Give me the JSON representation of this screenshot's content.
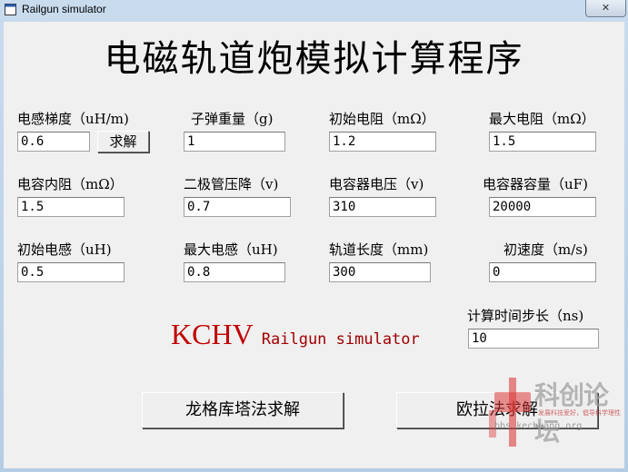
{
  "window": {
    "title": "Railgun simulator",
    "close_glyph": "✕"
  },
  "heading": "电磁轨道炮模拟计算程序",
  "fields": {
    "inductance_gradient": {
      "label": "电感梯度（uH/m)",
      "value": "0.6"
    },
    "bullet_mass": {
      "label": "子弹重量（g)",
      "value": "1"
    },
    "initial_resistance": {
      "label": "初始电阻（mΩ）",
      "value": "1.2"
    },
    "max_resistance": {
      "label": "最大电阻（mΩ）",
      "value": "1.5"
    },
    "capacitor_esr": {
      "label": "电容内阻（mΩ）",
      "value": "1.5"
    },
    "diode_drop": {
      "label": "二极管压降（v)",
      "value": "0.7"
    },
    "capacitor_voltage": {
      "label": "电容器电压（v)",
      "value": "310"
    },
    "capacitance": {
      "label": "电容器容量（uF)",
      "value": "20000"
    },
    "initial_inductance": {
      "label": "初始电感（uH)",
      "value": "0.5"
    },
    "max_inductance": {
      "label": "最大电感（uH)",
      "value": "0.8"
    },
    "rail_length": {
      "label": "轨道长度（mm)",
      "value": "300"
    },
    "initial_velocity": {
      "label": "初速度（m/s)",
      "value": "0"
    },
    "time_step": {
      "label": "计算时间步长（ns)",
      "value": "10"
    }
  },
  "buttons": {
    "solve": "求解",
    "runge_kutta": "龙格库塔法求解",
    "euler": "欧拉法求解"
  },
  "brand": {
    "logo": "KCHV",
    "subtitle": "Railgun simulator"
  },
  "watermark": {
    "title": "科创论坛",
    "slogan": "发展科技爱好，倡导科学理性",
    "url": "bbs.kechuang.org"
  },
  "colors": {
    "brand_red": "#c00000",
    "client_bg": "#f0f0f0"
  },
  "icons": {
    "app": "window-icon",
    "close": "close-icon"
  }
}
